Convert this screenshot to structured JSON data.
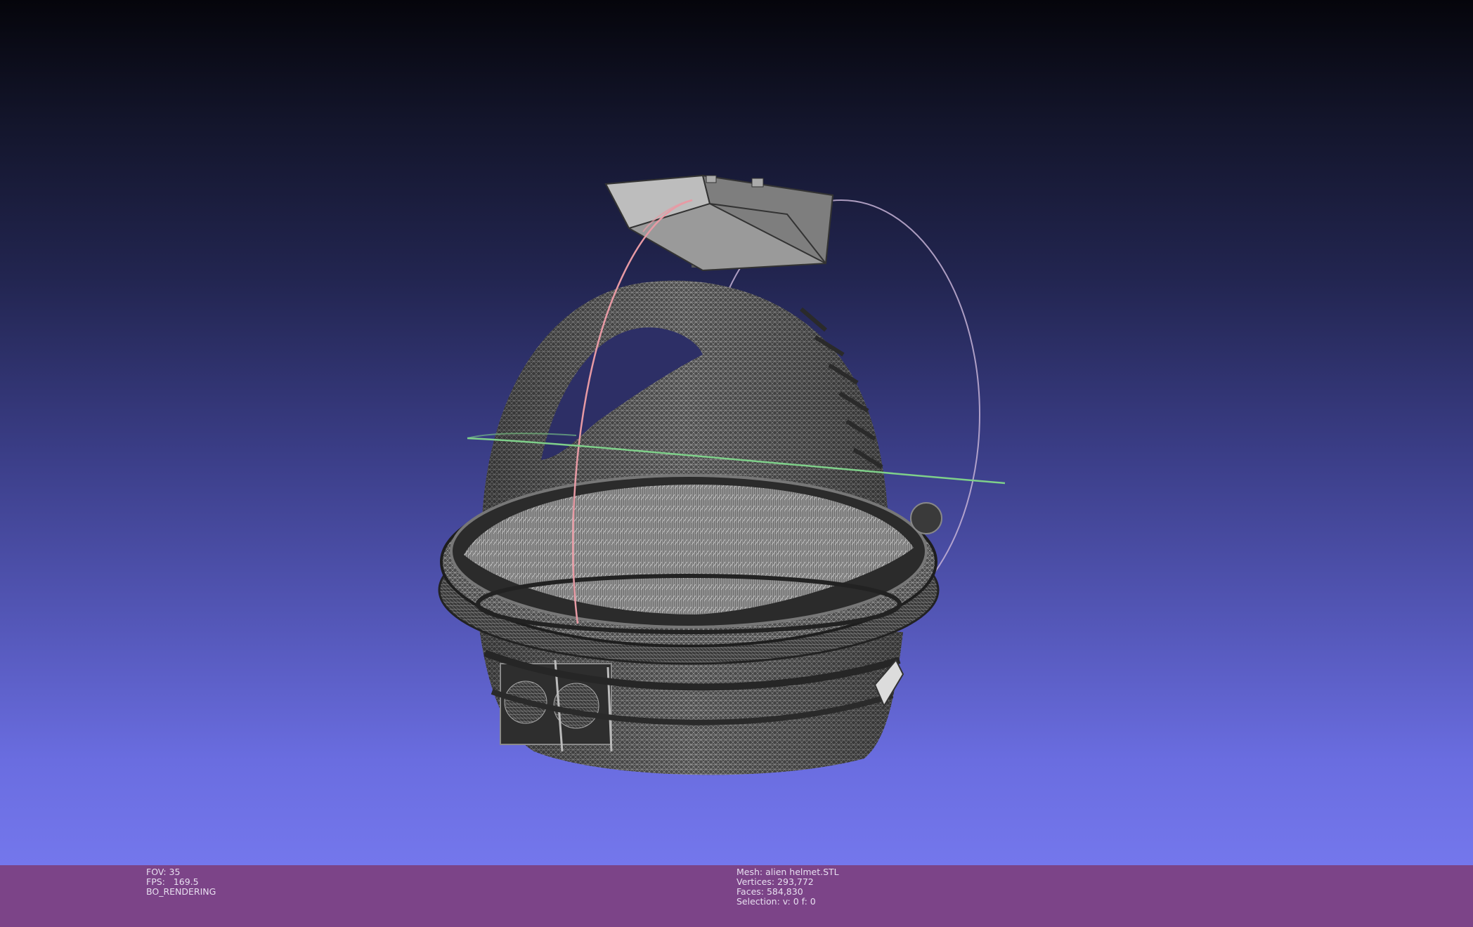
{
  "viewport": {
    "model": "alien helmet",
    "render_mode": "wireframe",
    "trackball": {
      "x_ring_color": "#e79aa4",
      "y_ring_color": "#7fd08a",
      "z_ring_color": "#c6b3d6"
    },
    "background_top": "#05050b",
    "background_bottom": "#7477ec"
  },
  "status_bar": {
    "background": "#7c4488",
    "left": {
      "fov": "FOV: 35",
      "fps": "FPS:   169.5",
      "rendering": "BO_RENDERING"
    },
    "right": {
      "mesh": "Mesh: alien helmet.STL",
      "vertices": "Vertices: 293,772",
      "faces": "Faces: 584,830",
      "selection": "Selection: v: 0 f: 0"
    }
  }
}
